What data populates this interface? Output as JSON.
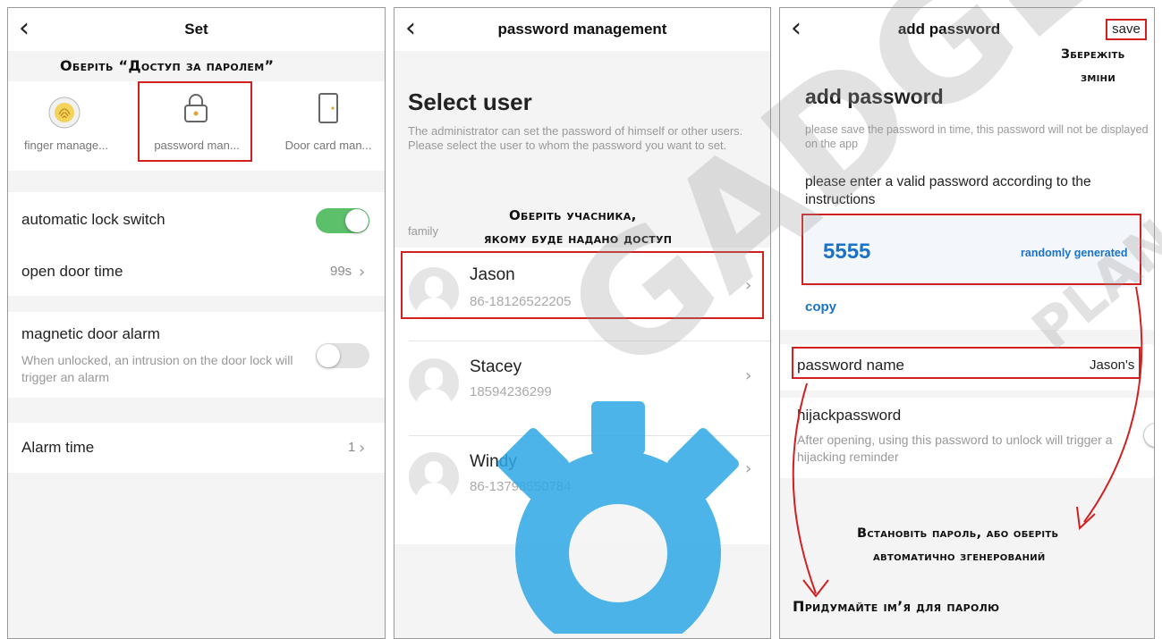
{
  "panel1": {
    "title": "Set",
    "annotation": "Оберіть “Доступ за паролем”",
    "tiles": [
      {
        "label": "finger manage...",
        "icon": "fingerprint-icon"
      },
      {
        "label": "password man...",
        "icon": "lock-icon"
      },
      {
        "label": "Door card man...",
        "icon": "door-icon"
      }
    ],
    "auto_lock_label": "automatic lock switch",
    "open_door_label": "open door time",
    "open_door_value": "99s",
    "magnetic_label": "magnetic door alarm",
    "magnetic_desc": "When unlocked, an intrusion on the door lock will trigger an alarm",
    "alarm_time_label": "Alarm time",
    "alarm_time_value": "1",
    "accent_color": "#5cbf6a"
  },
  "panel2": {
    "title": "password management",
    "heading": "Select user",
    "description": "The administrator can set the password of himself or other users. Please select the user to whom the password you want to set.",
    "group_label": "family",
    "annotation_line1": "Оберіть учасника,",
    "annotation_line2": "якому буде надано доступ",
    "users": [
      {
        "name": "Jason",
        "phone": "86-18126522205"
      },
      {
        "name": "Stacey",
        "phone": "18594236299"
      },
      {
        "name": "Windy",
        "phone": "86-13798550784"
      }
    ]
  },
  "panel3": {
    "title": "add password",
    "save_label": "save",
    "save_annotation_line1": "Збережіть",
    "save_annotation_line2": "зміни",
    "heading": "add password",
    "note": "please save the password in time, this password will not be displayed on the app",
    "instruction": "please enter a valid password according to the instructions",
    "password_value": "5555",
    "random_label": "randomly generated",
    "copy_label": "copy",
    "password_name_label": "password name",
    "password_name_value": "Jason's",
    "hijack_label": "hijackpassword",
    "hijack_desc": "After opening, using this password to unlock will trigger a hijacking reminder",
    "annotation_set_line1": "Встановіть пароль, або оберіть",
    "annotation_set_line2": "автоматично згенерований",
    "annotation_name": "Придумайте ім’я для паролю",
    "link_color": "#1a73c8"
  },
  "watermark": {
    "text": "GADGET",
    "sub": "PLAN"
  }
}
